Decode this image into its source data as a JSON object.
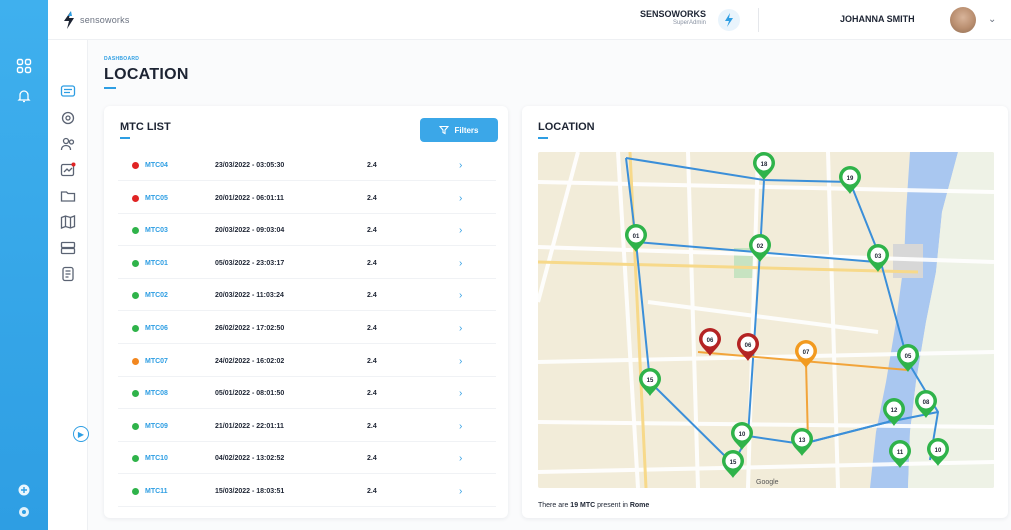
{
  "app": {
    "logo_text": "sensoworks"
  },
  "topbar": {
    "org_name": "SENSOWORKS",
    "org_role": "SuperAdmin",
    "user_name": "JOHANNA SMITH"
  },
  "breadcrumb": "DASHBOARD",
  "page_title": "LOCATION",
  "mtc_list": {
    "title": "MTC LIST",
    "filters_label": "Filters",
    "rows": [
      {
        "id": "MTC04",
        "date": "23/03/2022 - 03:05:30",
        "value": "2.4",
        "status": "red"
      },
      {
        "id": "MTC05",
        "date": "20/01/2022 - 06:01:11",
        "value": "2.4",
        "status": "red"
      },
      {
        "id": "MTC03",
        "date": "20/03/2022 - 09:03:04",
        "value": "2.4",
        "status": "green"
      },
      {
        "id": "MTC01",
        "date": "05/03/2022 - 23:03:17",
        "value": "2.4",
        "status": "green"
      },
      {
        "id": "MTC02",
        "date": "20/03/2022 - 11:03:24",
        "value": "2.4",
        "status": "green"
      },
      {
        "id": "MTC06",
        "date": "26/02/2022 - 17:02:50",
        "value": "2.4",
        "status": "green"
      },
      {
        "id": "MTC07",
        "date": "24/02/2022 - 16:02:02",
        "value": "2.4",
        "status": "orange"
      },
      {
        "id": "MTC08",
        "date": "05/01/2022 - 08:01:50",
        "value": "2.4",
        "status": "green"
      },
      {
        "id": "MTC09",
        "date": "21/01/2022 - 22:01:11",
        "value": "2.4",
        "status": "green"
      },
      {
        "id": "MTC10",
        "date": "04/02/2022 - 13:02:52",
        "value": "2.4",
        "status": "green"
      },
      {
        "id": "MTC11",
        "date": "15/03/2022 - 18:03:51",
        "value": "2.4",
        "status": "green"
      }
    ]
  },
  "location_card": {
    "title": "LOCATION",
    "caption_prefix": "There are ",
    "caption_count": "19 MTC",
    "caption_mid": " present in ",
    "caption_city": "Rome"
  },
  "map": {
    "pins": [
      {
        "label": "06",
        "color": "#b42323"
      },
      {
        "label": "06",
        "color": "#b42323"
      },
      {
        "label": "07",
        "color": "#f29a1f"
      },
      {
        "label": "18",
        "color": "#2fb34a"
      },
      {
        "label": "19",
        "color": "#2fb34a"
      },
      {
        "label": "01",
        "color": "#2fb34a"
      },
      {
        "label": "02",
        "color": "#2fb34a"
      },
      {
        "label": "03",
        "color": "#2fb34a"
      },
      {
        "label": "15",
        "color": "#2fb34a"
      },
      {
        "label": "05",
        "color": "#2fb34a"
      },
      {
        "label": "12",
        "color": "#2fb34a"
      },
      {
        "label": "08",
        "color": "#2fb34a"
      },
      {
        "label": "10",
        "color": "#2fb34a"
      },
      {
        "label": "13",
        "color": "#2fb34a"
      },
      {
        "label": "15",
        "color": "#2fb34a"
      },
      {
        "label": "11",
        "color": "#2fb34a"
      },
      {
        "label": "10",
        "color": "#2fb34a"
      }
    ],
    "attribution": "Google"
  },
  "colors": {
    "accent": "#2e9ee3",
    "status_red": "#e02424",
    "status_green": "#2fb34a",
    "status_orange": "#f2871f"
  }
}
